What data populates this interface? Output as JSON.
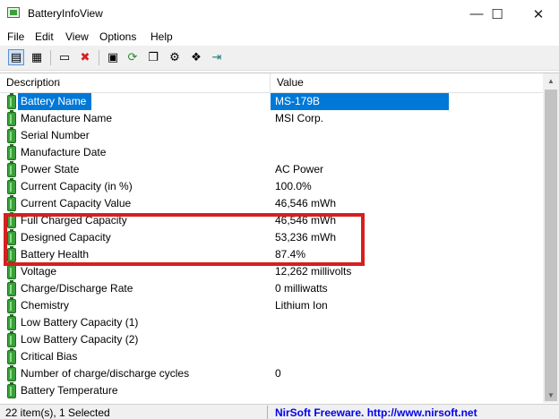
{
  "window": {
    "title": "BatteryInfoView",
    "minimize": "—",
    "maximize": "☐",
    "close": "✕"
  },
  "menu": [
    "File",
    "Edit",
    "View",
    "Options",
    "Help"
  ],
  "toolbar": {
    "buttons": [
      {
        "name": "html-report-icon",
        "glyph": "▤"
      },
      {
        "name": "log-view-icon",
        "glyph": "▦"
      },
      {
        "name": "properties-icon",
        "glyph": "▭"
      },
      {
        "name": "delete-icon",
        "glyph": "✖"
      },
      {
        "name": "save-icon",
        "glyph": "▣"
      },
      {
        "name": "refresh-icon",
        "glyph": "⟳"
      },
      {
        "name": "copy-icon",
        "glyph": "❐"
      },
      {
        "name": "options-icon",
        "glyph": "⚙"
      },
      {
        "name": "exit-icon",
        "glyph": "⇥"
      }
    ]
  },
  "columns": {
    "description": "Description",
    "value": "Value",
    "sort_indicator": "/"
  },
  "rows": [
    {
      "description": "Battery Name",
      "value": "MS-179B"
    },
    {
      "description": "Manufacture Name",
      "value": "MSI Corp."
    },
    {
      "description": "Serial Number",
      "value": ""
    },
    {
      "description": "Manufacture Date",
      "value": ""
    },
    {
      "description": "Power State",
      "value": "AC Power"
    },
    {
      "description": "Current Capacity (in %)",
      "value": "100.0%"
    },
    {
      "description": "Current Capacity Value",
      "value": "46,546 mWh"
    },
    {
      "description": "Full Charged Capacity",
      "value": "46,546 mWh"
    },
    {
      "description": "Designed Capacity",
      "value": "53,236 mWh"
    },
    {
      "description": "Battery Health",
      "value": "87.4%"
    },
    {
      "description": "Voltage",
      "value": "12,262 millivolts"
    },
    {
      "description": "Charge/Discharge Rate",
      "value": "0 milliwatts"
    },
    {
      "description": "Chemistry",
      "value": "Lithium Ion"
    },
    {
      "description": "Low Battery Capacity (1)",
      "value": ""
    },
    {
      "description": "Low Battery Capacity (2)",
      "value": ""
    },
    {
      "description": "Critical Bias",
      "value": ""
    },
    {
      "description": "Number of charge/discharge cycles",
      "value": "0"
    },
    {
      "description": "Battery Temperature",
      "value": ""
    }
  ],
  "selected_row": "Battery Name",
  "status": {
    "items": "22 item(s), 1 Selected",
    "link": "NirSoft Freeware.  http://www.nirsoft.net"
  },
  "colors": {
    "selection": "#0078d7",
    "highlight_box": "#d61f1f",
    "link": "#0000ee"
  }
}
